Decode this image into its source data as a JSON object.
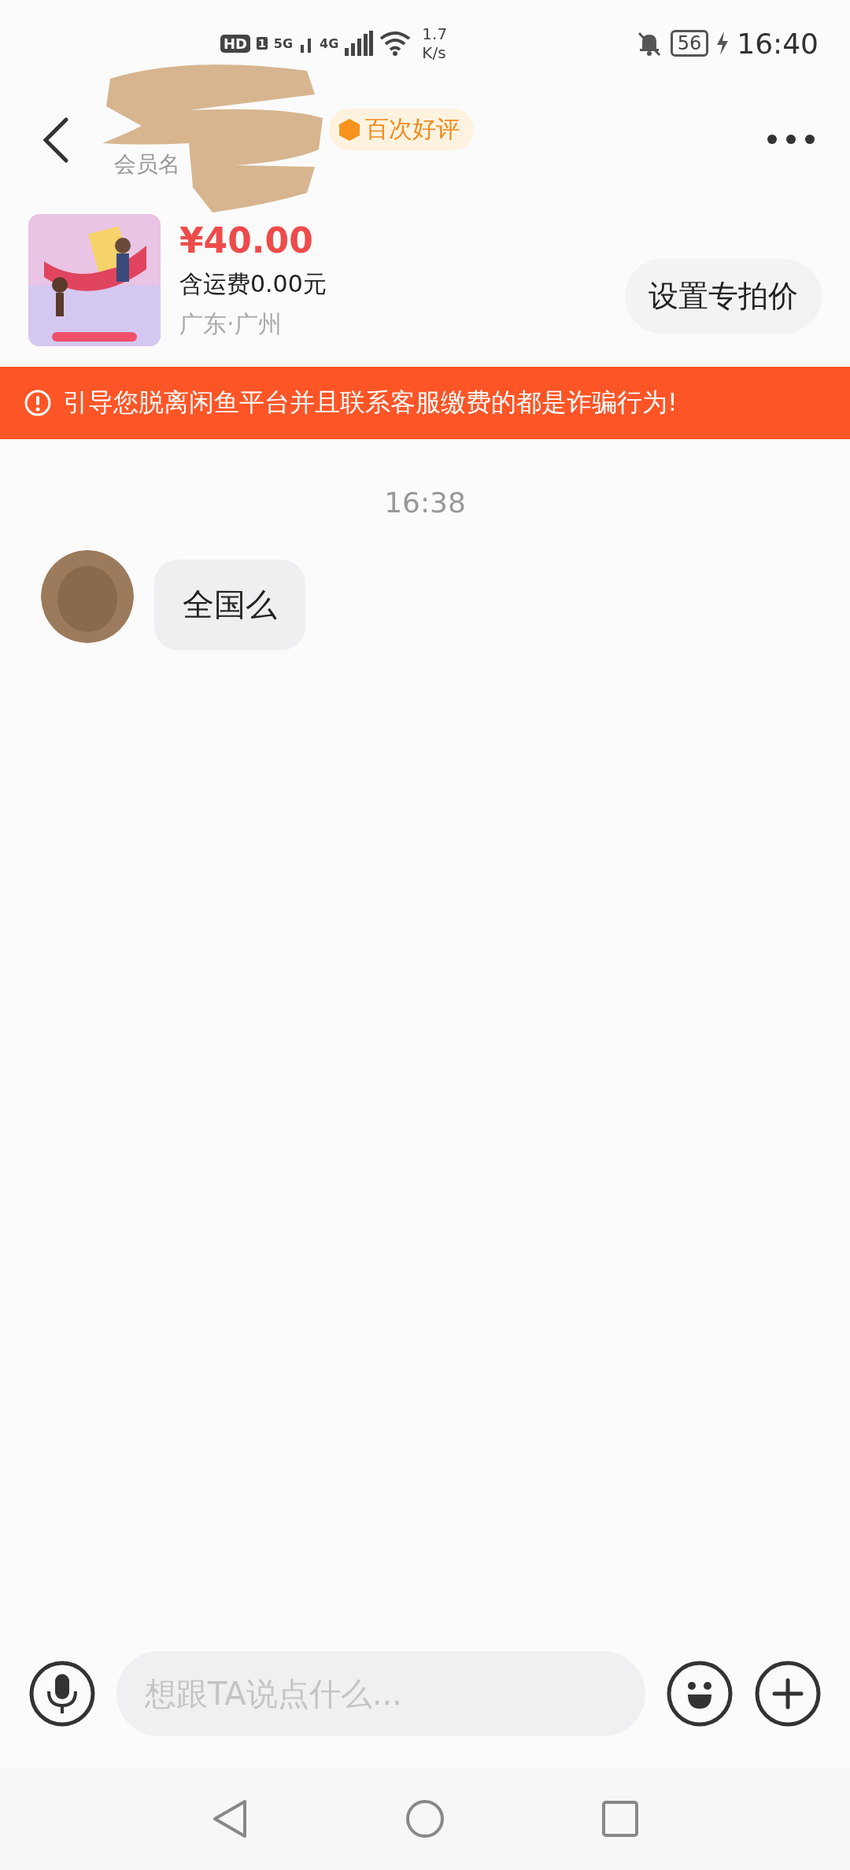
{
  "status_bar": {
    "network_badge": "HD",
    "sim": "1",
    "network_1": "5G",
    "network_2": "4G",
    "speed_value": "1.7",
    "speed_unit": "K/s",
    "battery": "56",
    "time": "16:40"
  },
  "header": {
    "badge": "百次好评",
    "member_label": "会员名"
  },
  "product": {
    "price": "¥40.00",
    "shipping": "含运费0.00元",
    "location": "广东·广州",
    "action": "设置专拍价"
  },
  "warning": {
    "text": "引导您脱离闲鱼平台并且联系客服缴费的都是诈骗行为!"
  },
  "messages": [
    {
      "kind": "time",
      "text": "16:38"
    },
    {
      "kind": "incoming",
      "text": "全国么"
    }
  ],
  "composer": {
    "placeholder": "想跟TA说点什么..."
  }
}
